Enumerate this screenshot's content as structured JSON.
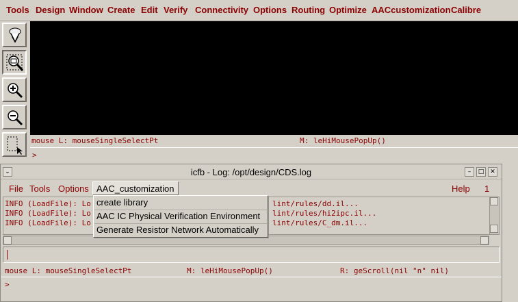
{
  "top_window": {
    "menu": [
      "Tools",
      "Design",
      "Window",
      "Create",
      "Edit",
      "Verify",
      "Connectivity",
      "Options",
      "Routing",
      "Optimize",
      "AACcustomization",
      "Calibre"
    ],
    "toolbar_icons": [
      "save-down-icon",
      "zoom-fit-icon",
      "zoom-in-icon",
      "zoom-out-icon",
      "select-box-icon"
    ],
    "status_left": "mouse L: mouseSingleSelectPt",
    "status_middle": "M: leHiMousePopUp()",
    "prompt": ">"
  },
  "ciw": {
    "title": "icfb - Log: /opt/design/CDS.log",
    "title_buttons": [
      "⌄",
      "–",
      "□",
      "✕"
    ],
    "menu": [
      "File",
      "Tools",
      "Options"
    ],
    "active_menu": "AAC_customization",
    "help": "Help",
    "help_number": "1",
    "log_lines": [
      {
        "left": "INFO (LoadFile): Lo",
        "right": "lint/rules/dd.il..."
      },
      {
        "left": "INFO (LoadFile): Lo",
        "right": "lint/rules/hi2ipc.il..."
      },
      {
        "left": "INFO (LoadFile): Lo",
        "right": "lint/rules/C_dm.il..."
      }
    ],
    "status_left": "mouse L: mouseSingleSelectPt",
    "status_middle": "M: leHiMousePopUp()",
    "status_right": "R: geScroll(nil \"n\" nil)",
    "prompt": ">"
  },
  "dropdown": {
    "items": [
      "create library",
      "AAC IC Physical Verification Environment",
      "Generate Resistor Network Automatically"
    ]
  },
  "colors": {
    "menu_text": "#8b0000",
    "canvas": "#000000",
    "chrome": "#d4d0c8"
  }
}
